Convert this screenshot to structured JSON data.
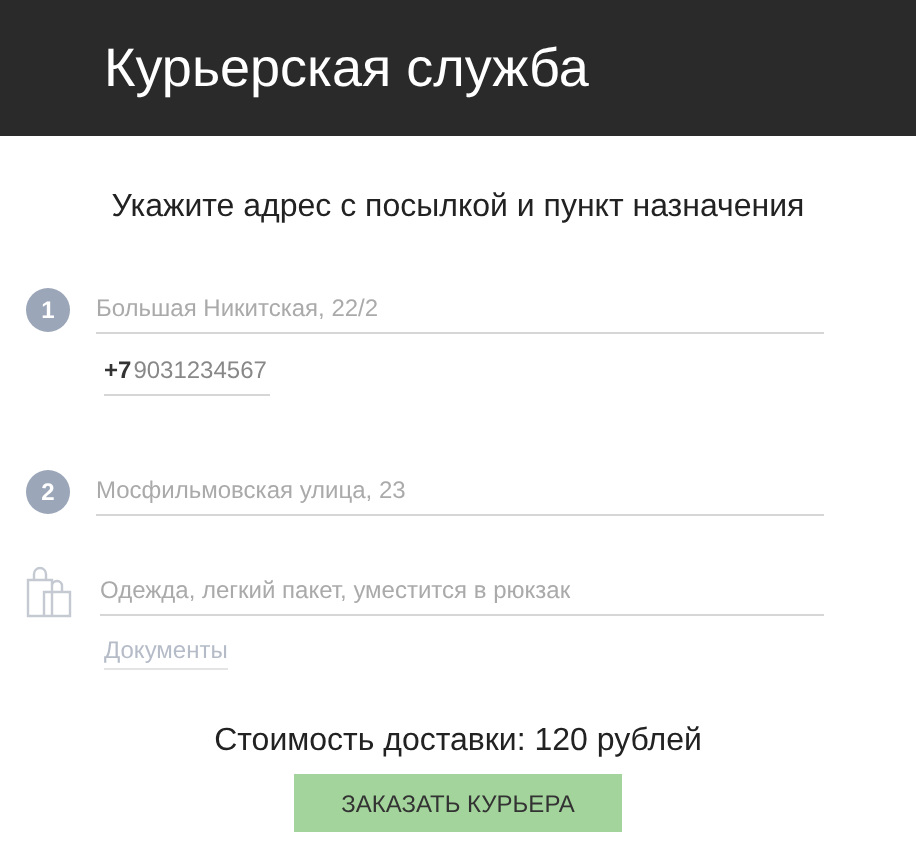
{
  "header": {
    "title": "Курьерская служба"
  },
  "heading": "Укажите адрес с посылкой и пункт назначения",
  "pickup": {
    "step": "1",
    "address": {
      "placeholder": "Большая Никитская, 22/2"
    },
    "phone": {
      "prefix": "+7",
      "placeholder": "9031234567"
    }
  },
  "destination": {
    "step": "2",
    "address": {
      "placeholder": "Мосфильмовская улица, 23"
    }
  },
  "parcel": {
    "description": {
      "placeholder": "Одежда, легкий пакет, уместится в рюкзак"
    },
    "suggestion": "Документы"
  },
  "price": "Стоимость доставки: 120 рублей",
  "order_button": "ЗАКАЗАТЬ КУРЬЕРА"
}
